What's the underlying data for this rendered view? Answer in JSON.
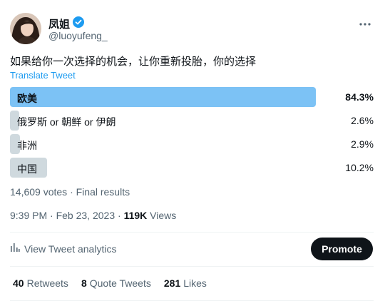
{
  "author": {
    "display_name": "凤姐",
    "handle": "@luoyufeng_"
  },
  "tweet": {
    "text": "如果给你一次选择的机会，让你重新投胎，你的选择",
    "translate_label": "Translate Tweet"
  },
  "poll": {
    "options": [
      {
        "label": "欧美",
        "percent_text": "84.3%",
        "percent": 84.3,
        "winner": true
      },
      {
        "label": "俄罗斯 or 朝鲜 or 伊朗",
        "percent_text": "2.6%",
        "percent": 2.6,
        "winner": false
      },
      {
        "label": "非洲",
        "percent_text": "2.9%",
        "percent": 2.9,
        "winner": false
      },
      {
        "label": "中国",
        "percent_text": "10.2%",
        "percent": 10.2,
        "winner": false
      }
    ],
    "votes": "14,609 votes",
    "status": "Final results",
    "separator": "·"
  },
  "meta": {
    "time": "9:39 PM",
    "date": "Feb 23, 2023",
    "views_count": "119K",
    "views_label": "Views",
    "separator": "·"
  },
  "actions": {
    "analytics_label": "View Tweet analytics",
    "promote_label": "Promote"
  },
  "stats": {
    "retweets_count": "40",
    "retweets_label": "Retweets",
    "quotes_count": "8",
    "quotes_label": "Quote Tweets",
    "likes_count": "281",
    "likes_label": "Likes"
  },
  "colors": {
    "accent": "#1d9bf0",
    "winner_bar": "#7cc2f5",
    "other_bar": "#cfd9de",
    "text": "#0f1419",
    "muted": "#536471"
  },
  "icons": {
    "verified": "verified-badge-icon",
    "more": "more-dots-icon",
    "analytics": "bar-chart-icon"
  }
}
